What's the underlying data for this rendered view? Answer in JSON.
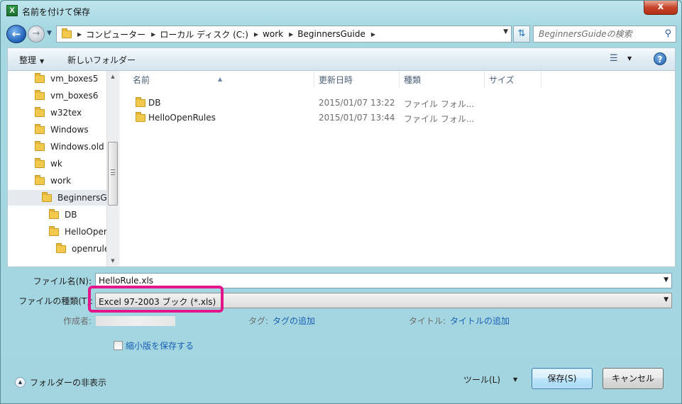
{
  "window": {
    "title": "名前を付けて保存",
    "close_label": "x",
    "app_icon_letter": "X"
  },
  "address": {
    "crumbs": [
      "コンピューター",
      "ローカル ディスク (C:)",
      "work",
      "BeginnersGuide"
    ],
    "search_placeholder": "BeginnersGuideの検索"
  },
  "toolbar": {
    "organize_label": "整理",
    "new_folder_label": "新しいフォルダー"
  },
  "nav_tree": [
    {
      "label": "vm_boxes5",
      "indent": 0
    },
    {
      "label": "vm_boxes6",
      "indent": 0
    },
    {
      "label": "w32tex",
      "indent": 0
    },
    {
      "label": "Windows",
      "indent": 0
    },
    {
      "label": "Windows.old",
      "indent": 0
    },
    {
      "label": "wk",
      "indent": 0
    },
    {
      "label": "work",
      "indent": 0
    },
    {
      "label": "BeginnersGuide",
      "indent": 1,
      "selected": true
    },
    {
      "label": "DB",
      "indent": 2
    },
    {
      "label": "HelloOpenRules",
      "indent": 2
    },
    {
      "label": "openrules",
      "indent": 3
    }
  ],
  "columns": {
    "name": "名前",
    "date": "更新日時",
    "type": "種類",
    "size": "サイズ"
  },
  "files": [
    {
      "name": "DB",
      "date": "2015/01/07 13:22",
      "type": "ファイル フォル..."
    },
    {
      "name": "HelloOpenRules",
      "date": "2015/01/07 13:44",
      "type": "ファイル フォル..."
    }
  ],
  "form": {
    "filename_label": "ファイル名(N):",
    "filename_value": "HelloRule.xls",
    "filetype_label": "ファイルの種類(T):",
    "filetype_value": "Excel 97-2003 ブック (*.xls)",
    "author_label": "作成者:",
    "tags_label": "タグ:",
    "tags_link": "タグの追加",
    "title_label": "タイトル:",
    "title_link": "タイトルの追加",
    "thumbnail_label": "縮小版を保存する"
  },
  "footer": {
    "hide_folders_label": "フォルダーの非表示",
    "tools_label": "ツール(L)",
    "save_label": "保存(S)",
    "cancel_label": "キャンセル"
  },
  "colors": {
    "highlight": "#e3158a",
    "link": "#1a5fb4",
    "chrome": "#a6d8e2"
  }
}
